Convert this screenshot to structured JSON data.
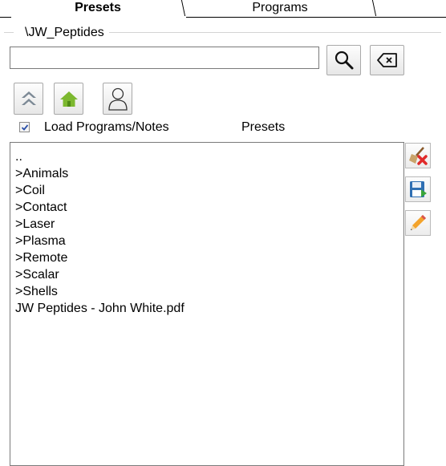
{
  "tabs": [
    {
      "label": "Presets",
      "active": true
    },
    {
      "label": "Programs",
      "active": false
    },
    {
      "label": "",
      "active": false
    }
  ],
  "path_label": "\\JW_Peptides",
  "search": {
    "value": "",
    "placeholder": ""
  },
  "toolbar": {
    "search_icon": "magnifier-icon",
    "clear_icon": "backspace-clear-icon",
    "up_icon": "double-chevron-up-icon",
    "home_icon": "home-icon",
    "user_icon": "user-icon"
  },
  "options": {
    "load_checked": true,
    "load_label": "Load Programs/Notes",
    "presets_label": "Presets"
  },
  "list": {
    "items": [
      "..",
      ">Animals",
      ">Coil",
      ">Contact",
      ">Laser",
      ">Plasma",
      ">Remote",
      ">Scalar",
      ">Shells",
      "JW Peptides - John White.pdf"
    ]
  },
  "side_buttons": {
    "delete_icon": "broom-delete-icon",
    "save_icon": "floppy-save-icon",
    "edit_icon": "pencil-edit-icon"
  },
  "colors": {
    "home_green": "#7cb82f",
    "up_chevron": "#7d8a96",
    "delete_red": "#e02a2a",
    "save_blue": "#2f6fb3",
    "pencil_orange": "#f3a32b"
  }
}
